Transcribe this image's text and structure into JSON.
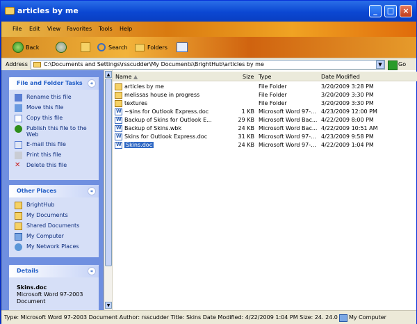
{
  "window": {
    "title": "articles by me"
  },
  "menu": [
    "File",
    "Edit",
    "View",
    "Favorites",
    "Tools",
    "Help"
  ],
  "toolbar": {
    "back": "Back",
    "search": "Search",
    "folders": "Folders"
  },
  "address": {
    "label": "Address",
    "path": "C:\\Documents and Settings\\rsscudder\\My Documents\\BrightHub\\articles by me",
    "go": "Go"
  },
  "file_tasks": {
    "title": "File and Folder Tasks",
    "items": [
      "Rename this file",
      "Move this file",
      "Copy this file",
      "Publish this file to the Web",
      "E-mail this file",
      "Print this file",
      "Delete this file"
    ]
  },
  "other_places": {
    "title": "Other Places",
    "items": [
      "BrightHub",
      "My Documents",
      "Shared Documents",
      "My Computer",
      "My Network Places"
    ]
  },
  "details": {
    "title": "Details",
    "name": "Skins.doc",
    "type1": "Microsoft Word 97-2003",
    "type2": "Document"
  },
  "columns": {
    "name": "Name",
    "size": "Size",
    "type": "Type",
    "date": "Date Modified"
  },
  "files": [
    {
      "name": "articles by me",
      "size": "",
      "type": "File Folder",
      "date": "3/20/2009 3:28 PM",
      "kind": "folder"
    },
    {
      "name": "melissas house in progress",
      "size": "",
      "type": "File Folder",
      "date": "3/20/2009 3:30 PM",
      "kind": "folder"
    },
    {
      "name": "textures",
      "size": "",
      "type": "File Folder",
      "date": "3/20/2009 3:30 PM",
      "kind": "folder"
    },
    {
      "name": "~$ins for Outlook Express.doc",
      "size": "1 KB",
      "type": "Microsoft Word 97-...",
      "date": "4/23/2009 12:00 PM",
      "kind": "doc"
    },
    {
      "name": "Backup of Skins for Outlook E...",
      "size": "29 KB",
      "type": "Microsoft Word Bac...",
      "date": "4/22/2009 8:00 PM",
      "kind": "doc"
    },
    {
      "name": "Backup of Skins.wbk",
      "size": "24 KB",
      "type": "Microsoft Word Bac...",
      "date": "4/22/2009 10:51 AM",
      "kind": "doc"
    },
    {
      "name": "Skins for Outlook Express.doc",
      "size": "31 KB",
      "type": "Microsoft Word 97-...",
      "date": "4/23/2009 9:58 PM",
      "kind": "doc"
    },
    {
      "name": "Skins.doc",
      "size": "24 KB",
      "type": "Microsoft Word 97-...",
      "date": "4/22/2009 1:04 PM",
      "kind": "doc",
      "selected": true
    }
  ],
  "status": {
    "text": "Type: Microsoft Word 97-2003 Document Author: rsscudder Title: Skins Date Modified: 4/22/2009 1:04 PM Size: 24.  24.0 KB",
    "location": "My Computer"
  }
}
